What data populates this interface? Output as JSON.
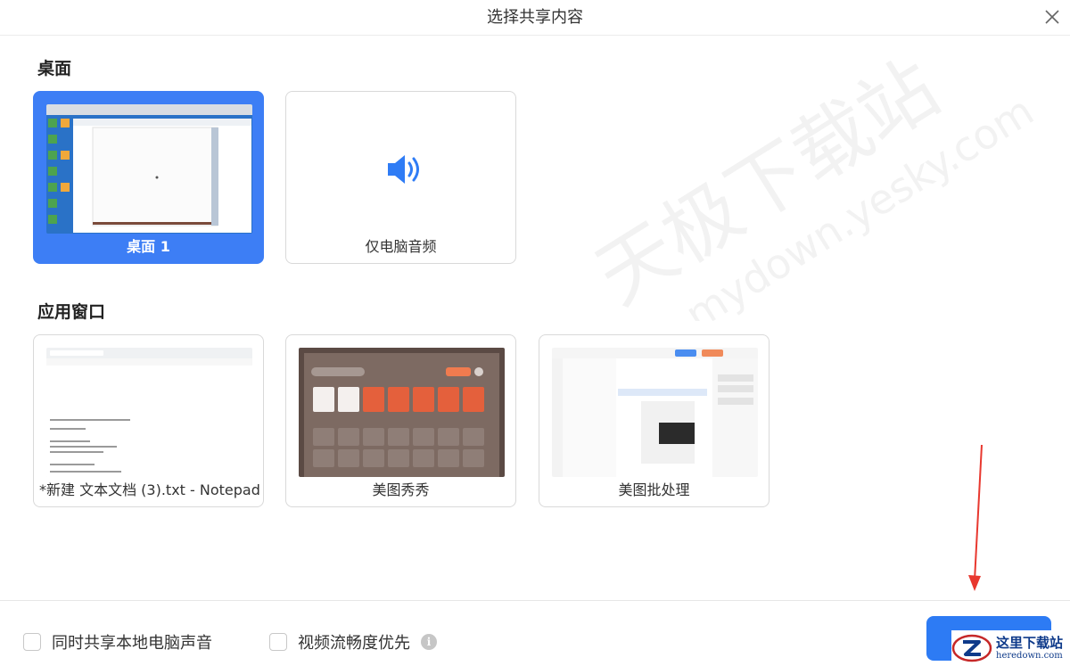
{
  "dialog": {
    "title": "选择共享内容"
  },
  "sections": {
    "desktop": {
      "title": "桌面"
    },
    "apps": {
      "title": "应用窗口"
    }
  },
  "cards": {
    "desktop1": {
      "label": "桌面 1",
      "selected": true
    },
    "audio_only": {
      "label": "仅电脑音频",
      "icon": "speaker-icon"
    },
    "notepad": {
      "label": "*新建 文本文档 (3).txt - Notepad",
      "thumb_tag": "*新建 文本文档(3).txt - Notepad"
    },
    "meitu_xiuxiu": {
      "label": "美图秀秀"
    },
    "meitu_batch": {
      "label": "美图批处理"
    }
  },
  "footer": {
    "share_sound_label": "同时共享本地电脑声音",
    "smooth_video_label": "视频流畅度优先",
    "share_sound_checked": false,
    "smooth_video_checked": false
  },
  "watermark": {
    "line1": "天极下载站",
    "line2": "mydown.yesky.com"
  },
  "badge": {
    "cn": "这里下载站",
    "en": "heredown.com"
  },
  "colors": {
    "accent": "#3d7ef5",
    "button": "#2d7bf4",
    "arrow": "#e8382f"
  }
}
